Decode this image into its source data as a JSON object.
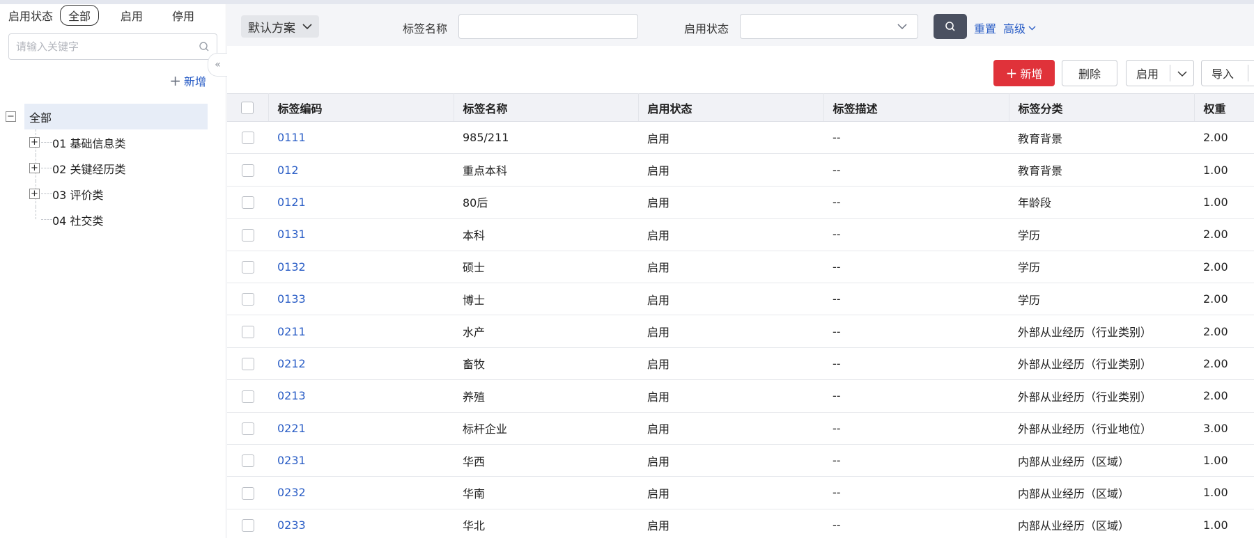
{
  "left_panel": {
    "status_label": "启用状态",
    "segments": [
      "全部",
      "启用",
      "停用"
    ],
    "search_placeholder": "请输入关键字",
    "add_label": "新增",
    "tree": {
      "root_label": "全部",
      "children": [
        "01 基础信息类",
        "02 关键经历类",
        "03 评价类",
        "04 社交类"
      ]
    }
  },
  "filter_bar": {
    "scheme_label": "默认方案",
    "tag_name_label": "标签名称",
    "tag_name_value": "",
    "status_label": "启用状态",
    "status_value": "",
    "reset_label": "重置",
    "advanced_label": "高级"
  },
  "toolbar": {
    "add_label": "新增",
    "delete_label": "删除",
    "enable_label": "启用",
    "import_label": "导入"
  },
  "table": {
    "columns": [
      "标签编码",
      "标签名称",
      "启用状态",
      "标签描述",
      "标签分类",
      "权重"
    ],
    "rows": [
      {
        "code": "0111",
        "name": "985/211",
        "status": "启用",
        "desc": "--",
        "category": "教育背景",
        "weight": "2.00"
      },
      {
        "code": "012",
        "name": "重点本科",
        "status": "启用",
        "desc": "--",
        "category": "教育背景",
        "weight": "1.00"
      },
      {
        "code": "0121",
        "name": "80后",
        "status": "启用",
        "desc": "--",
        "category": "年龄段",
        "weight": "1.00"
      },
      {
        "code": "0131",
        "name": "本科",
        "status": "启用",
        "desc": "--",
        "category": "学历",
        "weight": "2.00"
      },
      {
        "code": "0132",
        "name": "硕士",
        "status": "启用",
        "desc": "--",
        "category": "学历",
        "weight": "2.00"
      },
      {
        "code": "0133",
        "name": "博士",
        "status": "启用",
        "desc": "--",
        "category": "学历",
        "weight": "2.00"
      },
      {
        "code": "0211",
        "name": "水产",
        "status": "启用",
        "desc": "--",
        "category": "外部从业经历（行业类别）",
        "weight": "2.00"
      },
      {
        "code": "0212",
        "name": "畜牧",
        "status": "启用",
        "desc": "--",
        "category": "外部从业经历（行业类别）",
        "weight": "2.00"
      },
      {
        "code": "0213",
        "name": "养殖",
        "status": "启用",
        "desc": "--",
        "category": "外部从业经历（行业类别）",
        "weight": "2.00"
      },
      {
        "code": "0221",
        "name": "标杆企业",
        "status": "启用",
        "desc": "--",
        "category": "外部从业经历（行业地位）",
        "weight": "3.00"
      },
      {
        "code": "0231",
        "name": "华西",
        "status": "启用",
        "desc": "--",
        "category": "内部从业经历（区域）",
        "weight": "1.00"
      },
      {
        "code": "0232",
        "name": "华南",
        "status": "启用",
        "desc": "--",
        "category": "内部从业经历（区域）",
        "weight": "1.00"
      },
      {
        "code": "0233",
        "name": "华北",
        "status": "启用",
        "desc": "--",
        "category": "内部从业经历（区域）",
        "weight": "1.00"
      }
    ]
  },
  "colors": {
    "link": "#2b5ec6",
    "primary_button": "#e0323a",
    "search_button": "#4a5060",
    "tree_selected": "#e7edf7"
  }
}
